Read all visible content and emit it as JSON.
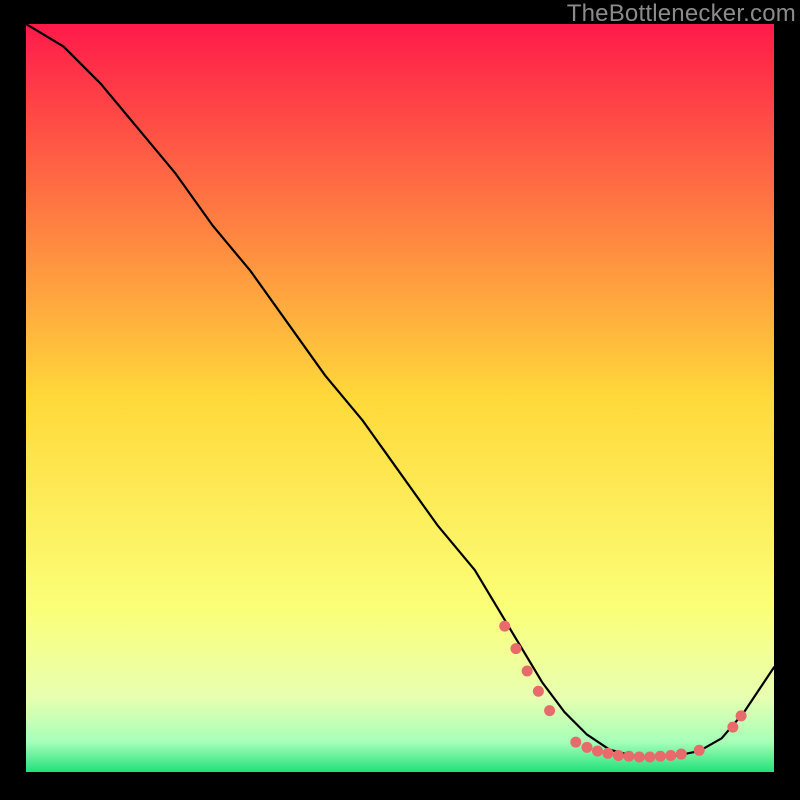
{
  "watermark": "TheBottlenecker.com",
  "chart_data": {
    "type": "line",
    "title": "",
    "xlabel": "",
    "ylabel": "",
    "xlim": [
      0,
      100
    ],
    "ylim": [
      0,
      100
    ],
    "background_gradient": {
      "stops": [
        {
          "pos": 0.0,
          "color": "#ff1a4a"
        },
        {
          "pos": 0.5,
          "color": "#ffd93a"
        },
        {
          "pos": 0.78,
          "color": "#fbff77"
        },
        {
          "pos": 0.9,
          "color": "#e8ffb1"
        },
        {
          "pos": 0.96,
          "color": "#a6ffb8"
        },
        {
          "pos": 1.0,
          "color": "#22e07a"
        }
      ]
    },
    "series": [
      {
        "name": "bottleneck-curve",
        "color": "#000000",
        "width": 2.2,
        "x": [
          0,
          5,
          10,
          15,
          20,
          25,
          30,
          35,
          40,
          45,
          50,
          55,
          60,
          63,
          66,
          69,
          72,
          75,
          78,
          81,
          84,
          87,
          90,
          93,
          96,
          100
        ],
        "y": [
          100,
          97,
          92,
          86,
          80,
          73,
          67,
          60,
          53,
          47,
          40,
          33,
          27,
          22,
          17,
          12,
          8,
          5,
          3,
          2.2,
          2.0,
          2.2,
          2.8,
          4.5,
          8,
          14
        ]
      }
    ],
    "highlight_points": {
      "name": "highlight",
      "color": "#e86b6b",
      "radius": 5.5,
      "points": [
        {
          "x": 64.0,
          "y": 19.5
        },
        {
          "x": 65.5,
          "y": 16.5
        },
        {
          "x": 67.0,
          "y": 13.5
        },
        {
          "x": 68.5,
          "y": 10.8
        },
        {
          "x": 70.0,
          "y": 8.2
        },
        {
          "x": 73.5,
          "y": 4.0
        },
        {
          "x": 75.0,
          "y": 3.3
        },
        {
          "x": 76.4,
          "y": 2.8
        },
        {
          "x": 77.8,
          "y": 2.5
        },
        {
          "x": 79.2,
          "y": 2.2
        },
        {
          "x": 80.6,
          "y": 2.1
        },
        {
          "x": 82.0,
          "y": 2.0
        },
        {
          "x": 83.4,
          "y": 2.0
        },
        {
          "x": 84.8,
          "y": 2.1
        },
        {
          "x": 86.2,
          "y": 2.2
        },
        {
          "x": 87.6,
          "y": 2.4
        },
        {
          "x": 90.0,
          "y": 2.9
        },
        {
          "x": 94.5,
          "y": 6.0
        },
        {
          "x": 95.6,
          "y": 7.5
        }
      ]
    }
  }
}
